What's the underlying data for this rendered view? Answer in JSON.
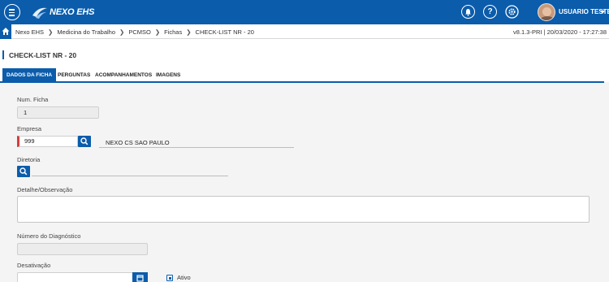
{
  "header": {
    "logo_text": "NEXO EHS",
    "user_name": "USUARIO TESTE",
    "icons": [
      "menu-icon",
      "bell-icon",
      "help-icon",
      "gear-icon",
      "avatar",
      "chevron-down-icon"
    ]
  },
  "breadcrumb": {
    "items": [
      "Nexo EHS",
      "Medicina do Trabalho",
      "PCMSO",
      "Fichas",
      "CHECK-LIST NR - 20"
    ],
    "version": "v8.1.3-PRI | 20/03/2020 - 17:27:38"
  },
  "page": {
    "title": "CHECK-LIST NR - 20"
  },
  "tabs": [
    {
      "label": "DADOS DA FICHA",
      "active": true
    },
    {
      "label": "PERGUNTAS",
      "active": false
    },
    {
      "label": "ACOMPANHAMENTOS",
      "active": false
    },
    {
      "label": "IMAGENS",
      "active": false
    }
  ],
  "form": {
    "num_ficha": {
      "label": "Num. Ficha",
      "value": "1"
    },
    "empresa": {
      "label": "Empresa",
      "value": "999",
      "name": "NEXO CS SAO PAULO"
    },
    "diretoria": {
      "label": "Diretoria",
      "value": ""
    },
    "detalhe": {
      "label": "Detalhe/Observação",
      "value": ""
    },
    "numero_diagnostico": {
      "label": "Número do Diagnóstico",
      "value": ""
    },
    "desativacao": {
      "label": "Desativação",
      "value": ""
    },
    "status": {
      "label": "Ativo",
      "checked": true
    }
  },
  "colors": {
    "primary": "#0b5cab",
    "required": "#d73b3b",
    "background": "#f4f4f4"
  }
}
